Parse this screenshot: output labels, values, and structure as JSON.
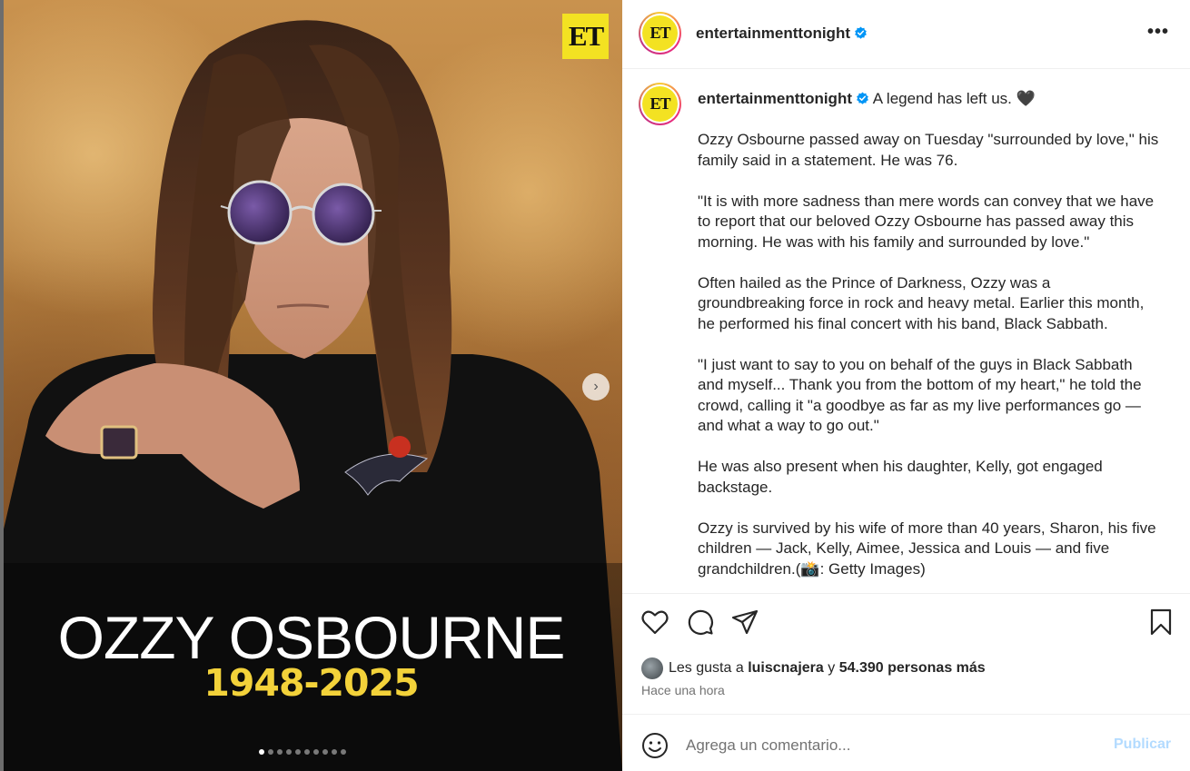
{
  "media": {
    "logo_text": "ET",
    "overlay_title": "OZZY OSBOURNE",
    "overlay_years": "1948-2025",
    "carousel_count": 10,
    "carousel_active_index": 0,
    "next_icon": "chevron-right-icon"
  },
  "header": {
    "avatar_text": "ET",
    "username": "entertainmenttonight",
    "verified_icon": "verified-badge-icon",
    "more_icon": "more-options-icon",
    "more_label": "•••"
  },
  "caption": {
    "avatar_text": "ET",
    "username": "entertainmenttonight",
    "headline": "A legend has left us. 🖤",
    "paragraphs": [
      "Ozzy Osbourne passed away on Tuesday \"surrounded by love,\" his family said in a statement. He was 76.",
      "\"It is with more sadness than mere words can convey that we have to report that our beloved Ozzy Osbourne has passed away this morning. He was with his family and surrounded by love.\"",
      "Often hailed as the Prince of Darkness, Ozzy was a groundbreaking force in rock and heavy metal. Earlier this month, he performed his final concert with his band, Black Sabbath.",
      "\"I just want to say to you on behalf of the guys in Black Sabbath and myself... Thank you from the bottom of my heart,\" he told the crowd, calling it \"a goodbye as far as my live performances go — and what a way to go out.\"",
      "He was also present when his daughter, Kelly, got engaged backstage.",
      "Ozzy is survived by his wife of more than 40 years, Sharon, his five children — Jack, Kelly, Aimee, Jessica and Louis — and five grandchildren.(📸: Getty Images)"
    ]
  },
  "actions": {
    "like_icon": "heart-icon",
    "comment_icon": "comment-bubble-icon",
    "share_icon": "paper-plane-icon",
    "save_icon": "bookmark-icon"
  },
  "likes": {
    "prefix": "Les gusta a",
    "user": "luiscnajera",
    "connector": "y",
    "count_text": "54.390 personas más"
  },
  "timestamp": "Hace una hora",
  "comment": {
    "emoji_icon": "emoji-smiley-icon",
    "placeholder": "Agrega un comentario...",
    "publish_label": "Publicar"
  }
}
